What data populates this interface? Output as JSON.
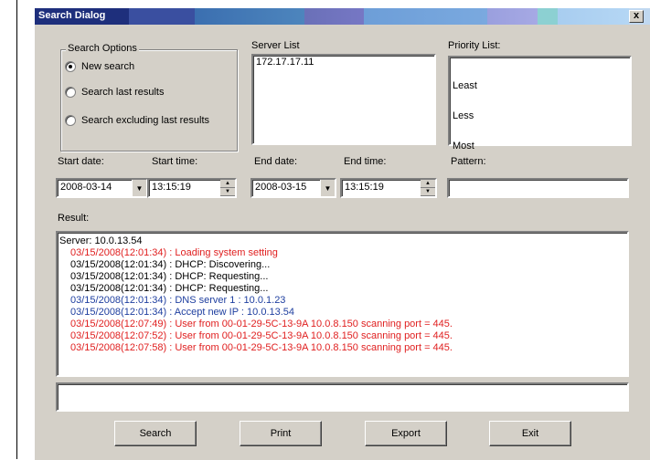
{
  "window": {
    "title": "Search Dialog",
    "close_label": "x"
  },
  "search_options": {
    "legend": "Search Options",
    "options": [
      "New search",
      "Search last results",
      "Search excluding last results"
    ],
    "selected_index": 0
  },
  "server_list": {
    "label": "Server List",
    "items": [
      "172.17.17.11"
    ]
  },
  "priority_list": {
    "label": "Priority List:",
    "items": [
      "Least",
      "Less",
      "Most"
    ]
  },
  "start_date": {
    "label": "Start date:",
    "value": "2008-03-14"
  },
  "start_time": {
    "label": "Start time:",
    "value": "13:15:19"
  },
  "end_date": {
    "label": "End date:",
    "value": "2008-03-15"
  },
  "end_time": {
    "label": "End time:",
    "value": "13:15:19"
  },
  "pattern": {
    "label": "Pattern:",
    "value": ""
  },
  "result": {
    "label": "Result:",
    "lines": [
      {
        "text": "Server: 10.0.13.54",
        "color": "#000000",
        "indent": false
      },
      {
        "text": "03/15/2008(12:01:34) : Loading system setting",
        "color": "#e02020",
        "indent": true
      },
      {
        "text": "03/15/2008(12:01:34) : DHCP: Discovering...",
        "color": "#000000",
        "indent": true
      },
      {
        "text": "03/15/2008(12:01:34) : DHCP: Requesting...",
        "color": "#000000",
        "indent": true
      },
      {
        "text": "03/15/2008(12:01:34) : DHCP: Requesting...",
        "color": "#000000",
        "indent": true
      },
      {
        "text": "03/15/2008(12:01:34) : DNS server 1 : 10.0.1.23",
        "color": "#2040a0",
        "indent": true
      },
      {
        "text": "03/15/2008(12:01:34) : Accept new IP : 10.0.13.54",
        "color": "#2040a0",
        "indent": true
      },
      {
        "text": "03/15/2008(12:07:49) : User from 00-01-29-5C-13-9A 10.0.8.150 scanning port = 445.",
        "color": "#e02020",
        "indent": true
      },
      {
        "text": "03/15/2008(12:07:52) : User from 00-01-29-5C-13-9A 10.0.8.150 scanning port = 445.",
        "color": "#e02020",
        "indent": true
      },
      {
        "text": "03/15/2008(12:07:58) : User from 00-01-29-5C-13-9A 10.0.8.150 scanning port = 445.",
        "color": "#e02020",
        "indent": true
      }
    ]
  },
  "buttons": {
    "search": "Search",
    "print": "Print",
    "export": "Export",
    "exit": "Exit"
  }
}
